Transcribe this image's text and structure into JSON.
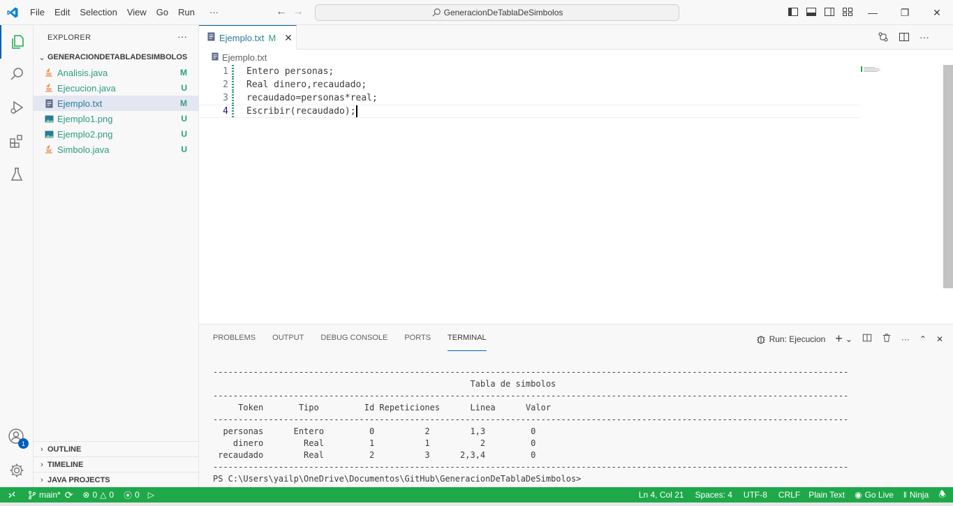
{
  "menu": [
    "File",
    "Edit",
    "Selection",
    "View",
    "Go",
    "Run",
    "···"
  ],
  "command_center": "GeneracionDeTablaDeSimbolos",
  "explorer": {
    "title": "EXPLORER",
    "folder": "GENERACIONDETABLADESIMBOLOS",
    "files": [
      {
        "name": "Analisis.java",
        "status": "M",
        "icon": "java-icon"
      },
      {
        "name": "Ejecucion.java",
        "status": "U",
        "icon": "java-icon"
      },
      {
        "name": "Ejemplo.txt",
        "status": "M",
        "icon": "text-file-icon"
      },
      {
        "name": "Ejemplo1.png",
        "status": "U",
        "icon": "image-icon"
      },
      {
        "name": "Ejemplo2.png",
        "status": "U",
        "icon": "image-icon"
      },
      {
        "name": "Simbolo.java",
        "status": "U",
        "icon": "java-icon"
      }
    ],
    "sections": [
      "OUTLINE",
      "TIMELINE",
      "JAVA PROJECTS"
    ]
  },
  "editor": {
    "tab_name": "Ejemplo.txt",
    "tab_status": "M",
    "breadcrumb": "Ejemplo.txt",
    "lines": [
      {
        "num": "1",
        "text": "Entero personas;"
      },
      {
        "num": "2",
        "text": "Real dinero,recaudado;"
      },
      {
        "num": "3",
        "text": "recaudado=personas*real;"
      },
      {
        "num": "4",
        "text": "Escribir(recaudado);"
      }
    ]
  },
  "panel": {
    "tabs": [
      "PROBLEMS",
      "OUTPUT",
      "DEBUG CONSOLE",
      "PORTS",
      "TERMINAL"
    ],
    "active_tab": "TERMINAL",
    "run_label": "Run: Ejecucion",
    "terminal_lines": [
      "------------------------------------------------------------------------------------------------------------------------------",
      "                                                   Tabla de simbolos",
      "------------------------------------------------------------------------------------------------------------------------------",
      "     Token       Tipo         Id Repeticiones      Linea      Valor",
      "------------------------------------------------------------------------------------------------------------------------------",
      "  personas      Entero         0          2        1,3         0",
      "    dinero        Real         1          1          2         0",
      " recaudado        Real         2          3      2,3,4         0",
      "------------------------------------------------------------------------------------------------------------------------------",
      "PS C:\\Users\\yailp\\OneDrive\\Documentos\\GitHub\\GeneracionDeTablaDeSimbolos>"
    ]
  },
  "statusbar": {
    "branch": "main*",
    "errors": "0",
    "warnings": "0",
    "ports": "0",
    "position": "Ln 4, Col 21",
    "spaces": "Spaces: 4",
    "encoding": "UTF-8",
    "eol": "CRLF",
    "language": "Plain Text",
    "golive": "Go Live",
    "ninja": "Ninja",
    "accounts_badge": "1"
  },
  "colors": {
    "accent": "#005fb8",
    "status_bar": "#1ea84a",
    "git_status": "#2a9d80"
  }
}
